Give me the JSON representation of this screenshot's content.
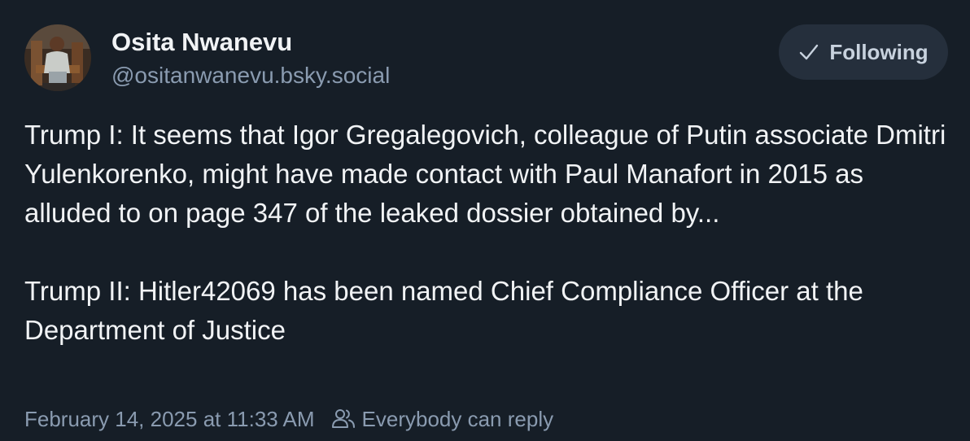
{
  "author": {
    "display_name": "Osita Nwanevu",
    "handle": "@ositanwanevu.bsky.social",
    "avatar_icon": "avatar-photo"
  },
  "follow_button": {
    "label": "Following",
    "icon": "check-icon"
  },
  "post": {
    "paragraphs": [
      "Trump I: It seems that Igor Gregalegovich, colleague of Putin associate Dmitri Yulenkorenko, might have made contact with Paul Manafort in 2015 as alluded to on page 347 of the leaked dossier obtained by...",
      "Trump II: Hitler42069 has been named Chief Compliance Officer at the Department of Justice"
    ]
  },
  "meta": {
    "timestamp": "February 14, 2025 at 11:33 AM",
    "reply_setting": "Everybody can reply",
    "reply_icon": "people-icon"
  },
  "colors": {
    "background": "#161e27",
    "text_primary": "#f1f3f5",
    "text_secondary": "#8a9bb0",
    "button_bg": "#252f3c"
  }
}
